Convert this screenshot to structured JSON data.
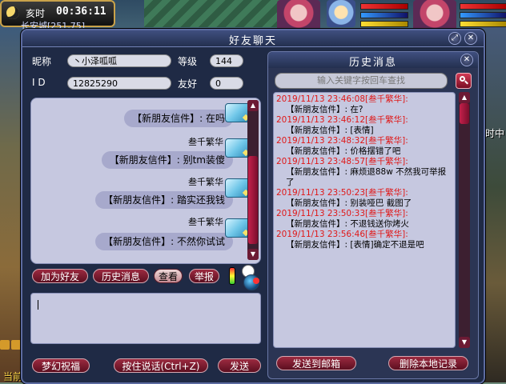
{
  "hud": {
    "time_label": "亥时",
    "clock": "00:36:11",
    "location": "长安城[251,75]",
    "side_label": "时中",
    "bottom_label": "当前"
  },
  "dialog": {
    "title": "好友聊天",
    "nickname_label": "昵称",
    "nickname_value": "丶小泽呱呱",
    "level_label": "等级",
    "level_value": "144",
    "id_label": "I  D",
    "id_value": "12825290",
    "friend_label": "友好",
    "friend_value": "0"
  },
  "chat": {
    "messages": [
      {
        "sender": "",
        "text": "【新朋友信件】: 在吗"
      },
      {
        "sender": "叁千繁华",
        "text": "【新朋友信件】: 别tm装傻"
      },
      {
        "sender": "叁千繁华",
        "text": "【新朋友信件】: 踏实还我钱"
      },
      {
        "sender": "叁千繁华",
        "text": "【新朋友信件】: 不然你试试"
      }
    ]
  },
  "buttons": {
    "add_friend": "加为好友",
    "history": "历史消息",
    "view": "查看",
    "report": "举报",
    "bless": "梦幻祝福",
    "voice": "按住说话(Ctrl+Z)",
    "send": "发送"
  },
  "history": {
    "title": "历史消息",
    "search_placeholder": "输入关键字按回车查找",
    "entries": [
      {
        "head": "2019/11/13 23:46:08[叁千繁华]:",
        "body": "【新朋友信件】: 在?"
      },
      {
        "head": "2019/11/13 23:46:12[叁千繁华]:",
        "body": "【新朋友信件】: [表情]"
      },
      {
        "head": "2019/11/13 23:48:32[叁千繁华]:",
        "body": "【新朋友信件】: 价格摆错了吧"
      },
      {
        "head": "2019/11/13 23:48:57[叁千繁华]:",
        "body": "【新朋友信件】: 麻烦退88w 不然我可举报了"
      },
      {
        "head": "2019/11/13 23:50:23[叁千繁华]:",
        "body": "【新朋友信件】: 别装哑巴 截图了"
      },
      {
        "head": "2019/11/13 23:50:33[叁千繁华]:",
        "body": "【新朋友信件】: 不退钱送你烤火"
      },
      {
        "head": "2019/11/13 23:56:46[叁千繁华]:",
        "body": "【新朋友信件】: [表情]确定不退是吧"
      }
    ],
    "send_mail": "发送到邮箱",
    "delete_local": "删除本地记录"
  },
  "colors": {
    "history_time": "#e01818",
    "dialog_bg": "#1f2a45",
    "panel_bg": "#c6c8e0"
  }
}
